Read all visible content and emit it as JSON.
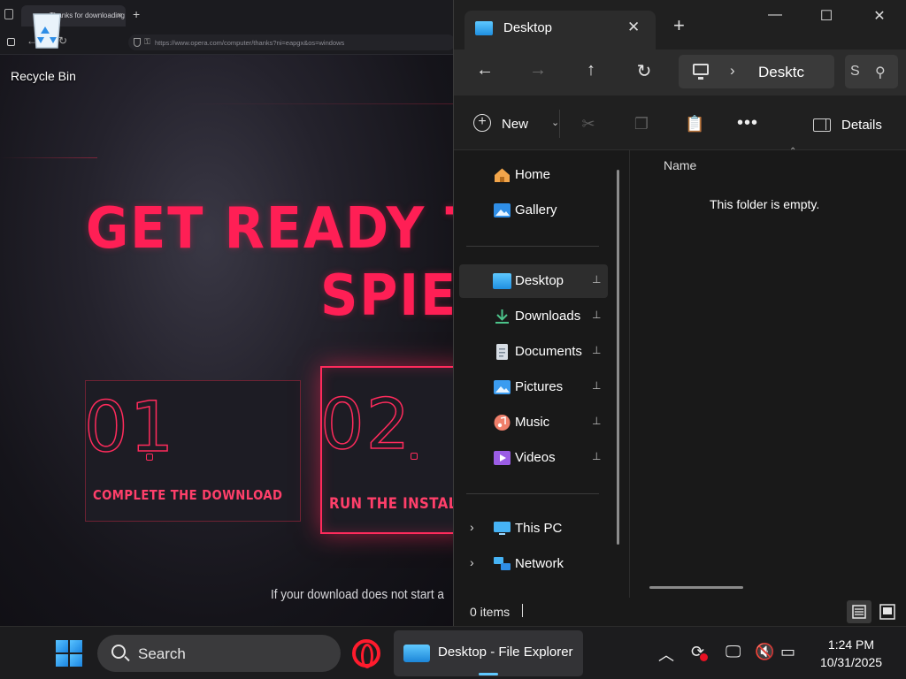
{
  "browser": {
    "tab_title": "Thanks for downloading Opera",
    "tab_close": "×",
    "new_tab": "+",
    "url": "https://www.opera.com/computer/thanks?ni=eapgx&os=windows",
    "headline_line1": "GET READY TO",
    "headline_line2": "SPIE",
    "step1_number": "01",
    "step1_caption": "COMPLETE THE DOWNLOAD",
    "step2_number": "02",
    "step2_caption": "RUN THE INSTAL",
    "download_note": "If your download does not start a"
  },
  "desktop": {
    "recycle_bin_label": "Recycle Bin"
  },
  "explorer": {
    "tab_title": "Desktop",
    "tab_close": "✕",
    "new_tab": "+",
    "window_controls": {
      "minimize": "—",
      "maximize": "☐",
      "close": "✕"
    },
    "breadcrumb_separator": "›",
    "breadcrumb_current": "Desktc",
    "search_placeholder_fragment": "S",
    "command_bar": {
      "new_label": "New",
      "details_label": "Details",
      "more_glyph": "•••"
    },
    "nav_pane": {
      "quick": [
        {
          "label": "Home",
          "icon": "home-icon"
        },
        {
          "label": "Gallery",
          "icon": "gallery-icon"
        }
      ],
      "pinned": [
        {
          "label": "Desktop",
          "icon": "desktop-folder-icon",
          "selected": true
        },
        {
          "label": "Downloads",
          "icon": "downloads-icon"
        },
        {
          "label": "Documents",
          "icon": "documents-icon"
        },
        {
          "label": "Pictures",
          "icon": "pictures-icon"
        },
        {
          "label": "Music",
          "icon": "music-icon"
        },
        {
          "label": "Videos",
          "icon": "videos-icon"
        }
      ],
      "locations": [
        {
          "label": "This PC",
          "icon": "this-pc-icon"
        },
        {
          "label": "Network",
          "icon": "network-icon"
        }
      ],
      "pin_glyph": "📌"
    },
    "content": {
      "column_name": "Name",
      "empty_message": "This folder is empty."
    },
    "status": {
      "item_count": "0 items"
    }
  },
  "taskbar": {
    "search_label": "Search",
    "explorer_task_label": "Desktop - File Explorer",
    "time": "1:24 PM",
    "date": "10/31/2025"
  },
  "colors": {
    "neon_red": "#ff1f55",
    "explorer_bg": "#191919",
    "accent_blue": "#60c9ff"
  }
}
